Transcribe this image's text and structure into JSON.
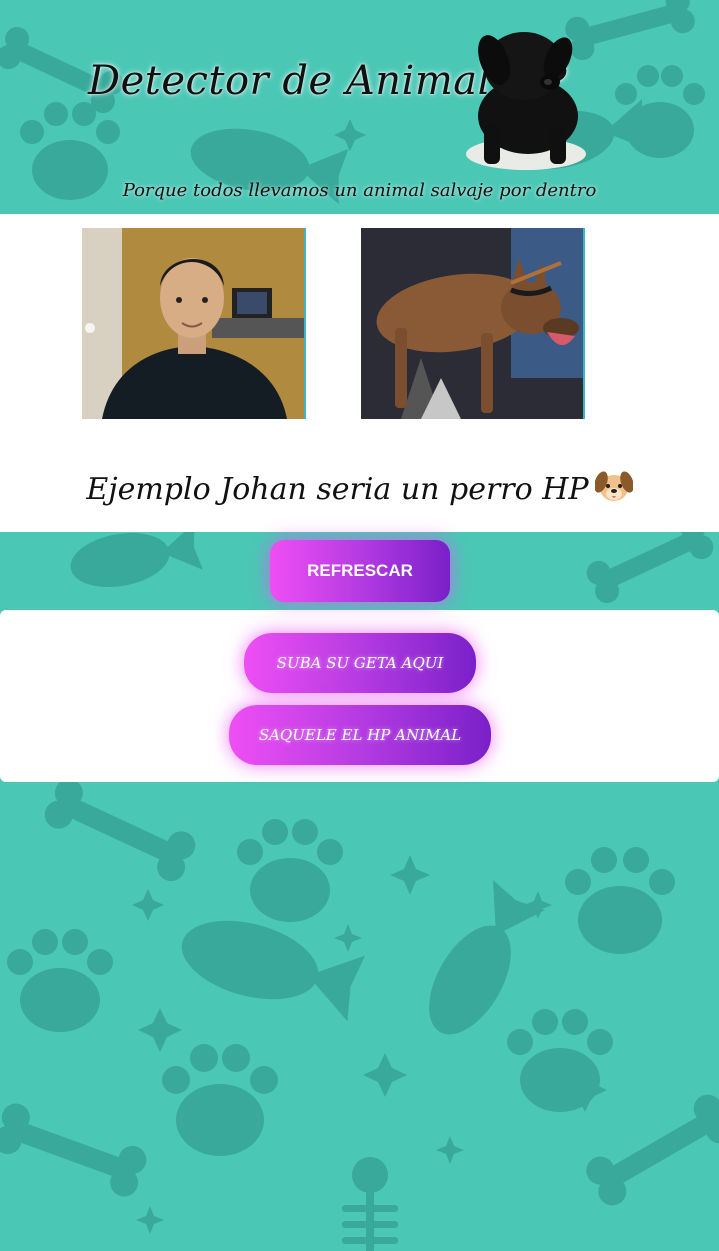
{
  "header": {
    "title": "Detector de Animal HP",
    "subtitle": "Porque todos llevamos un animal salvaje por dentro",
    "puppy_icon": "puppy-illustration"
  },
  "example": {
    "person_photo": "person-selfie",
    "animal_photo": "dog-photo",
    "caption": "Ejemplo Johan seria un perro HP",
    "caption_emoji": "dog-face-icon"
  },
  "actions": {
    "refresh_label": "REFRESCAR",
    "upload_label": "SUBA SU GETA AQUI",
    "detect_label": "SAQUELE EL HP ANIMAL"
  },
  "colors": {
    "background": "#4bc7b6",
    "pattern": "#38a99a",
    "button_gradient_start": "#ee4ff4",
    "button_gradient_end": "#7a20c9"
  }
}
